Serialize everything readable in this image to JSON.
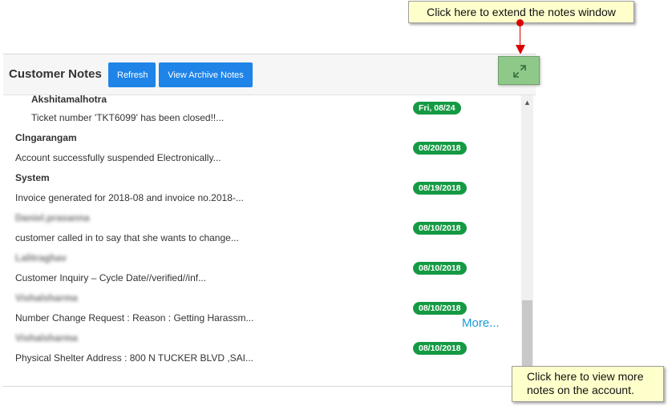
{
  "callouts": {
    "top": "Click here to extend the notes window",
    "bottom_line1": "Click here to view more",
    "bottom_line2": "notes on the account."
  },
  "header": {
    "title": "Customer Notes",
    "refresh_label": "Refresh",
    "archive_label": "View Archive Notes"
  },
  "notes": [
    {
      "author": "Akshitamalhotra",
      "text": "Ticket number 'TKT6099' has been closed!!...",
      "date": "Fri, 08/24"
    },
    {
      "author": "Clngarangam",
      "text": "Account successfully suspended Electronically...",
      "date": "08/20/2018"
    },
    {
      "author": "System",
      "text": "Invoice generated for 2018-08 and invoice no.2018-...",
      "date": "08/19/2018"
    },
    {
      "author": "Daniel.prasanna",
      "text": "customer called in to say that she wants to change...",
      "date": "08/10/2018"
    },
    {
      "author": "Lalitraghav",
      "text": "Customer Inquiry – Cycle Date//verified//inf...",
      "date": "08/10/2018"
    },
    {
      "author": "Vishalsharma",
      "text": "Number Change Request : Reason : Getting Harassm...",
      "date": "08/10/2018"
    },
    {
      "author": "Vishalsharma",
      "text": "Physical Shelter Address : 800 N TUCKER BLVD ,SAI...",
      "date": "08/10/2018"
    }
  ],
  "more_label": "More...",
  "colors": {
    "primary_button": "#1f84e8",
    "date_badge": "#159a43",
    "expand_button": "#8fc98a",
    "callout_bg": "#ffffcc",
    "pointer": "#d90000",
    "link": "#1a9ad6"
  },
  "icons": {
    "expand": "expand-arrows-icon",
    "scroll_up": "chevron-up-icon"
  }
}
